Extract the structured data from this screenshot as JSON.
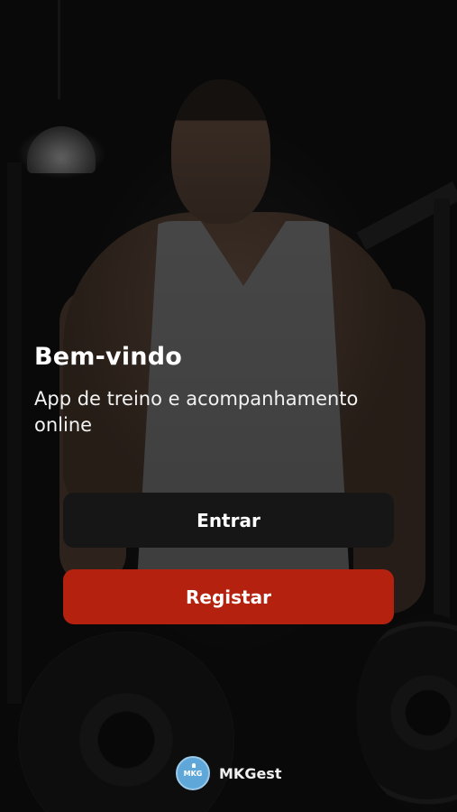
{
  "welcome": {
    "title": "Bem-vindo",
    "subtitle": "App de treino e acompanhamento online"
  },
  "actions": {
    "login_label": "Entrar",
    "register_label": "Registar"
  },
  "brand": {
    "logo_text": "MKG",
    "name": "MKGest"
  },
  "colors": {
    "login_button": "#161616",
    "register_button": "#b5210f",
    "logo": "#5fa7d8",
    "text": "#ffffff"
  },
  "icons": {
    "logo": "mkg-logo-icon"
  }
}
